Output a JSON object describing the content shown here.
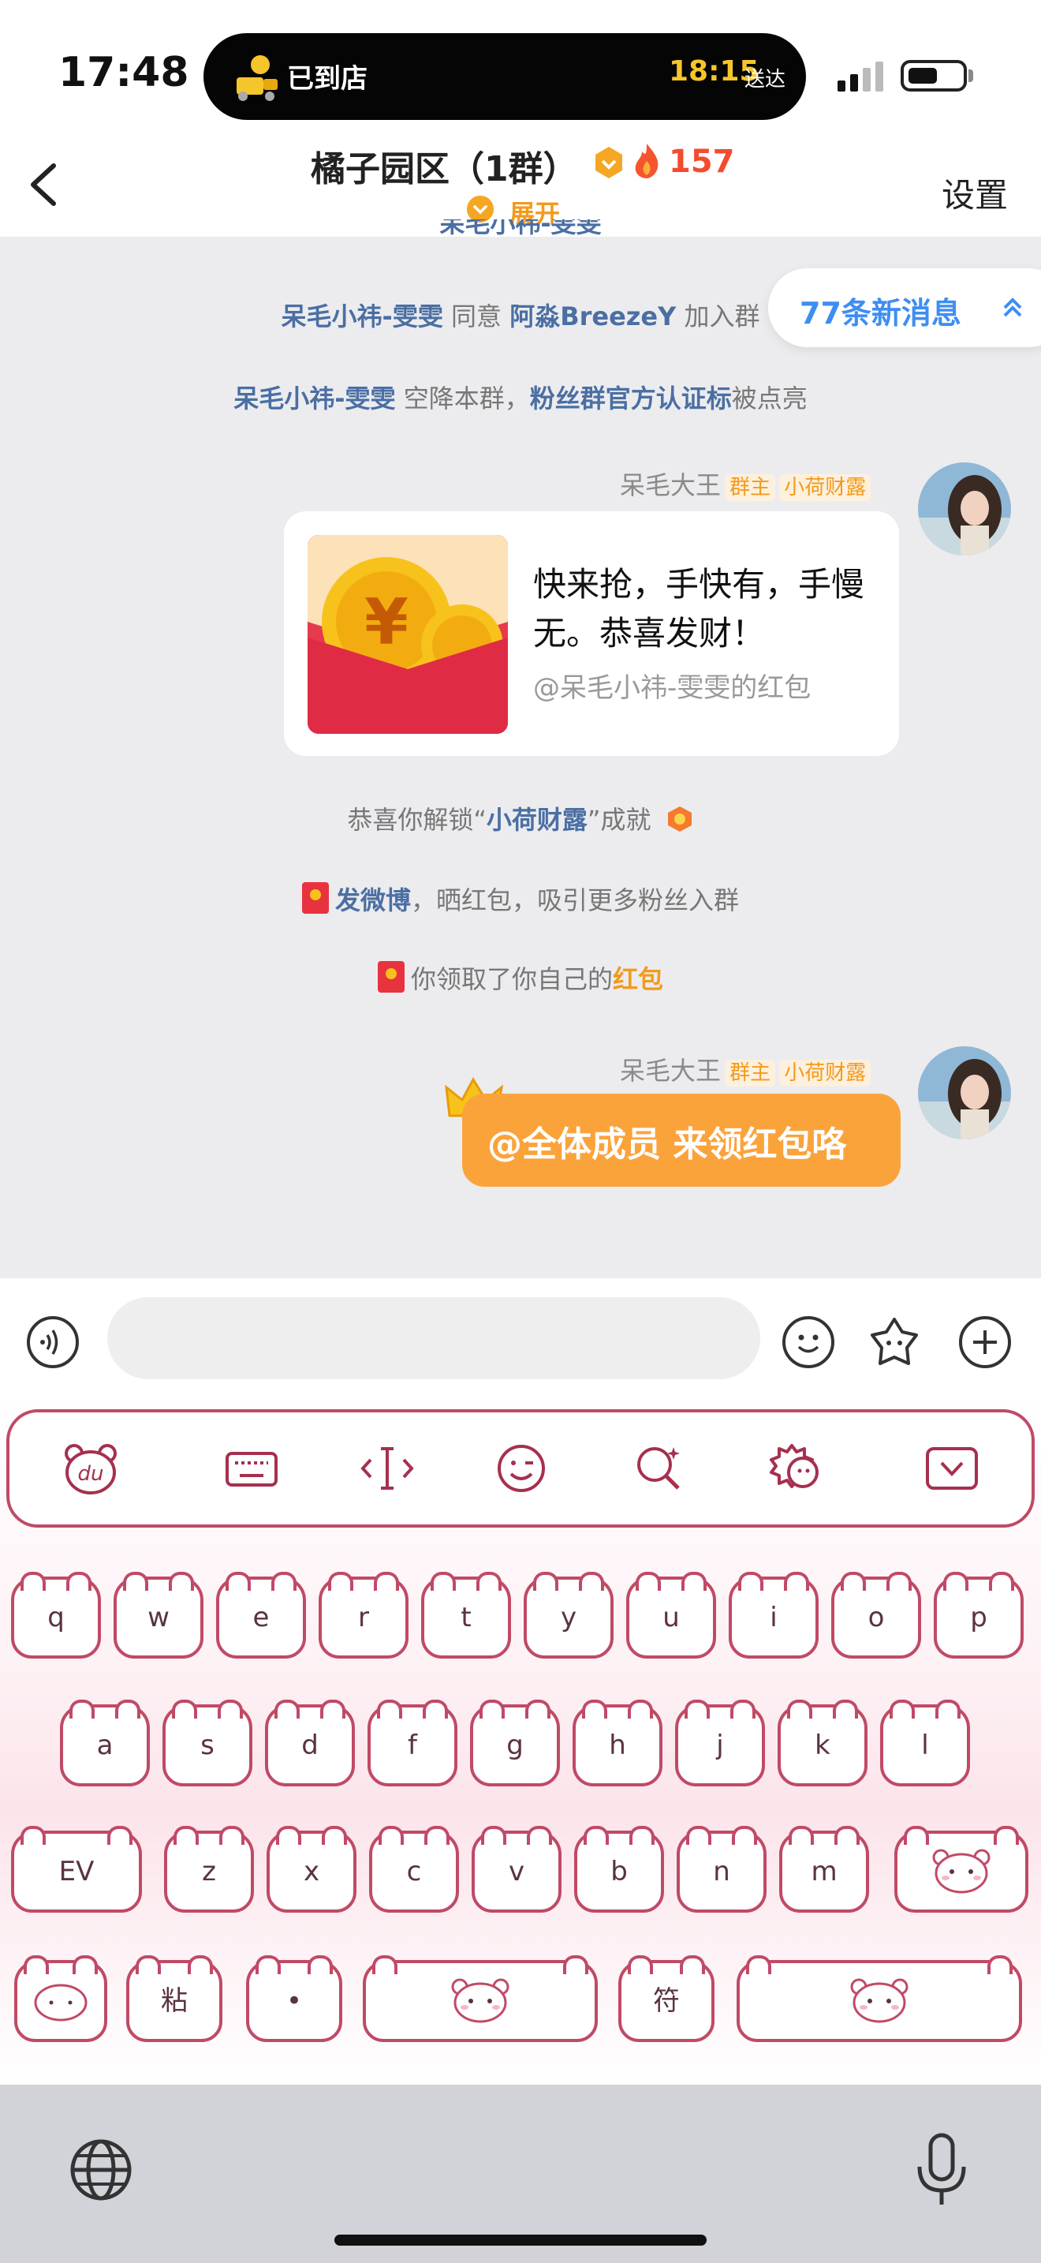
{
  "status_bar": {
    "time": "17:48",
    "island_text": "已到店",
    "island_time": "18:15",
    "island_sub": "送达"
  },
  "header": {
    "title": "橘子园区（1群）",
    "heat": "157",
    "expand_label": "展开",
    "settings_label": "设置",
    "icons": [
      "back-icon",
      "level-badge-icon",
      "fire-icon",
      "expand-icon"
    ]
  },
  "chat": {
    "new_messages_label": "77条新消息",
    "system_messages": [
      {
        "a": "呆毛小祎-雯雯",
        "b": " 同意 ",
        "c": "阿淼BreezeY",
        "d": " 加入群"
      },
      {
        "a": "呆毛小祎-雯雯",
        "b": " 空降本群，",
        "c": "粉丝群官方认证标",
        "d": "被点亮"
      }
    ],
    "msg1": {
      "sender": "呆毛大王",
      "role_tag": "群主",
      "fan_tag": "小荷财露",
      "red_packet_text": "快来抢，手快有，手慢无。恭喜发财！",
      "red_packet_sub": "@呆毛小祎-雯雯的红包"
    },
    "achievement": {
      "a": "恭喜你解锁“",
      "b": "小荷财露",
      "c": "”成就"
    },
    "weibo_tip": {
      "a": "发微博",
      "b": "，晒红包，吸引更多粉丝入群"
    },
    "claim_tip": {
      "a": "你领取了你自己的",
      "b": "红包"
    },
    "msg2": {
      "sender": "呆毛大王",
      "role_tag": "群主",
      "fan_tag": "小荷财露",
      "text": "@全体成员 来领红包咯"
    }
  },
  "input_bar": {
    "placeholder": "",
    "icons": [
      "voice-icon",
      "emoji-icon",
      "sticker-icon",
      "plus-icon"
    ]
  },
  "keyboard": {
    "toolbar_icons": [
      "bear-du-icon",
      "keyboard-icon",
      "cursor-icon",
      "wink-emoji-icon",
      "search-icon",
      "settings-icon",
      "collapse-icon"
    ],
    "row1": [
      "q",
      "w",
      "e",
      "r",
      "t",
      "y",
      "u",
      "i",
      "o",
      "p"
    ],
    "row2": [
      "a",
      "s",
      "d",
      "f",
      "g",
      "h",
      "j",
      "k",
      "l"
    ],
    "row3_left": "EV",
    "row3": [
      "z",
      "x",
      "c",
      "v",
      "b",
      "n",
      "m"
    ],
    "row4_second": "粘",
    "row4_third": "•",
    "row4_fifth": "符"
  },
  "colors": {
    "accent_orange": "#fba33b",
    "link_blue": "#4b6fa3",
    "new_msg_blue": "#3e8ef2",
    "heat_red": "#f44b2f",
    "keyboard_stroke": "#c04a66"
  }
}
